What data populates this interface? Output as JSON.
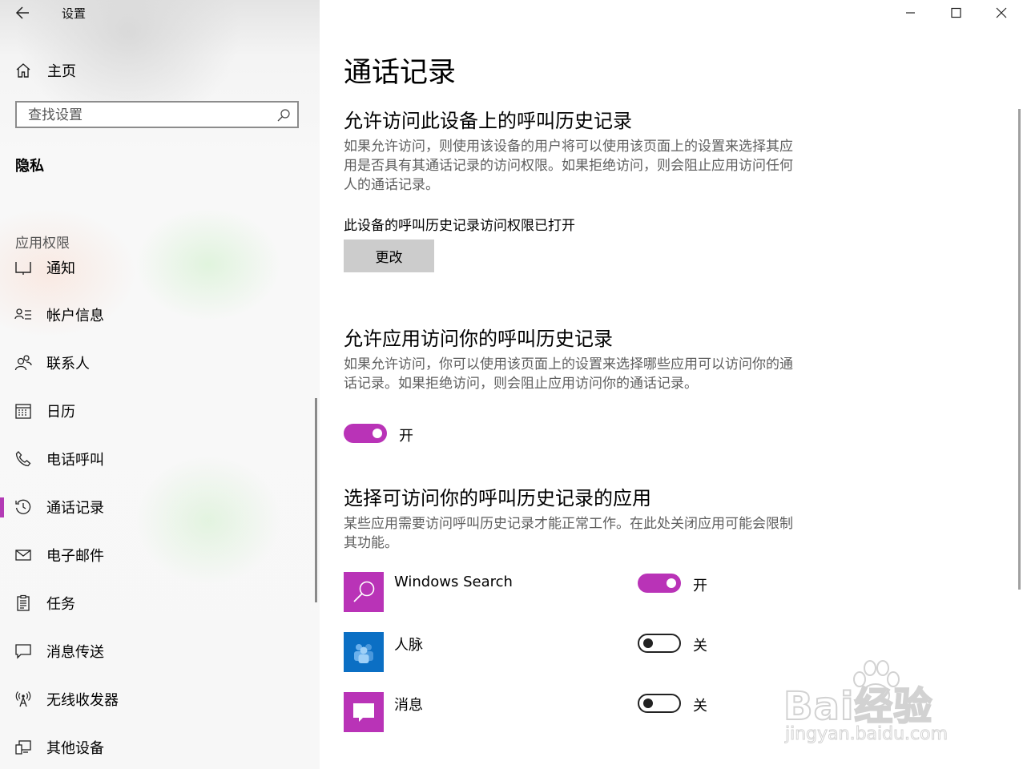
{
  "window": {
    "title": "设置",
    "controls": [
      "minimize-icon",
      "maximize-icon",
      "close-icon"
    ]
  },
  "sidebar": {
    "home_label": "主页",
    "search_placeholder": "查找设置",
    "section_title": "隐私",
    "group_label": "应用权限",
    "items": [
      {
        "label": "通知",
        "icon": "notification-icon"
      },
      {
        "label": "帐户信息",
        "icon": "account-info-icon"
      },
      {
        "label": "联系人",
        "icon": "contacts-icon"
      },
      {
        "label": "日历",
        "icon": "calendar-icon"
      },
      {
        "label": "电话呼叫",
        "icon": "phone-icon"
      },
      {
        "label": "通话记录",
        "icon": "history-icon",
        "selected": true
      },
      {
        "label": "电子邮件",
        "icon": "email-icon"
      },
      {
        "label": "任务",
        "icon": "tasks-icon"
      },
      {
        "label": "消息传送",
        "icon": "messaging-icon"
      },
      {
        "label": "无线收发器",
        "icon": "radio-icon"
      },
      {
        "label": "其他设备",
        "icon": "other-devices-icon"
      }
    ]
  },
  "main": {
    "title": "通话记录",
    "device_section": {
      "heading": "允许访问此设备上的呼叫历史记录",
      "description": "如果允许访问，则使用该设备的用户将可以使用该页面上的设置来选择其应用是否具有其通话记录的访问权限。如果拒绝访问，则会阻止应用访问任何人的通话记录。",
      "status": "此设备的呼叫历史记录访问权限已打开",
      "change_button": "更改"
    },
    "app_access_section": {
      "heading": "允许应用访问你的呼叫历史记录",
      "description": "如果允许访问，你可以使用该页面上的设置来选择哪些应用可以访问你的通话记录。如果拒绝访问，则会阻止应用访问你的通话记录。",
      "toggle_on": true,
      "toggle_label": "开"
    },
    "apps_section": {
      "heading": "选择可访问你的呼叫历史记录的应用",
      "description": "某些应用需要访问呼叫历史记录才能正常工作。在此处关闭应用可能会限制其功能。",
      "apps": [
        {
          "name": "Windows Search",
          "icon": "windows-search-icon",
          "tile_color": "#b933b7",
          "on": true,
          "state_label": "开"
        },
        {
          "name": "人脉",
          "icon": "people-app-icon",
          "tile_color": "#0b6fc4",
          "on": false,
          "state_label": "关"
        },
        {
          "name": "消息",
          "icon": "messaging-app-icon",
          "tile_color": "#b933b7",
          "on": false,
          "state_label": "关"
        }
      ]
    }
  },
  "watermark": {
    "brand": "Bai经验",
    "url": "jingyan.baidu.com"
  },
  "colors": {
    "accent": "#b933b7",
    "people_tile": "#0b6fc4",
    "description_text": "#5e5e5e",
    "button_gray": "#cccccc"
  }
}
